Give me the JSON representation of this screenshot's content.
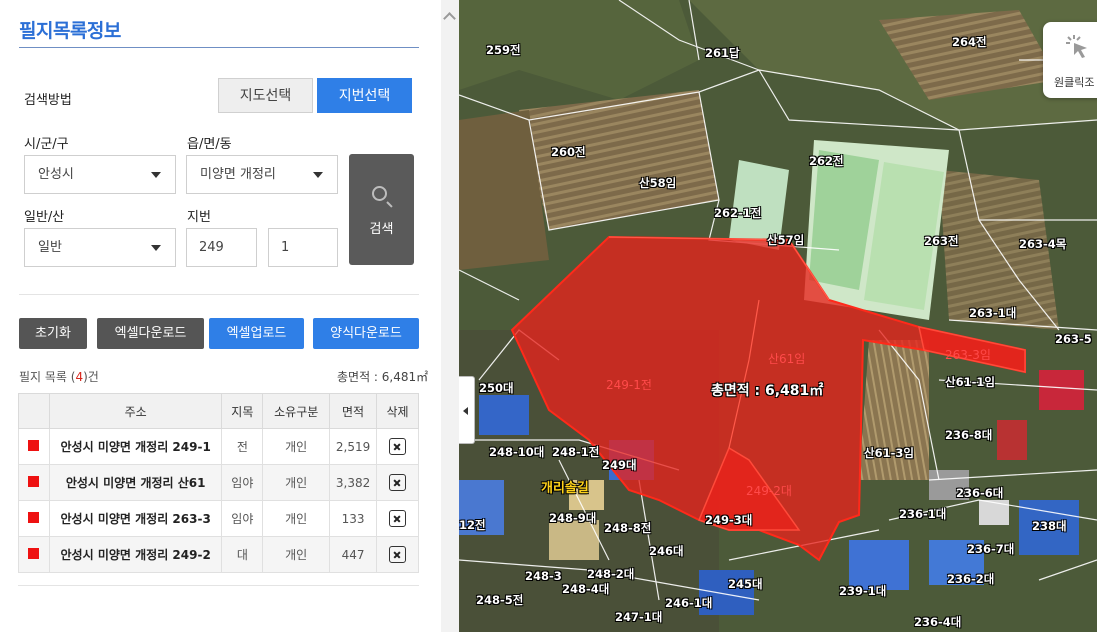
{
  "panel": {
    "title": "필지목록정보",
    "search_method_label": "검색방법",
    "toggle_map": "지도선택",
    "toggle_lot": "지번선택",
    "city_label": "시/군/구",
    "city_value": "안성시",
    "town_label": "읍/면/동",
    "town_value": "미양면 개정리",
    "type_label": "일반/산",
    "type_value": "일반",
    "lot_label": "지번",
    "lot_main": "249",
    "lot_sub": "1",
    "search_button": "검색",
    "actions": [
      "초기화",
      "엑셀다운로드",
      "엑셀업로드",
      "양식다운로드"
    ],
    "count_prefix": "필지 목록 (",
    "count_value": "4",
    "count_suffix": ")건",
    "total_area": "총면적 : 6,481㎡",
    "table": {
      "headers": [
        "",
        "주소",
        "지목",
        "소유구분",
        "면적",
        "삭제"
      ],
      "rows": [
        {
          "address": "안성시 미양면 개정리 249-1",
          "category": "전",
          "ownership": "개인",
          "area": "2,519"
        },
        {
          "address": "안성시 미양면 개정리 산61",
          "category": "임야",
          "ownership": "개인",
          "area": "3,382"
        },
        {
          "address": "안성시 미양면 개정리 263-3",
          "category": "임야",
          "ownership": "개인",
          "area": "133"
        },
        {
          "address": "안성시 미양면 개정리 249-2",
          "category": "대",
          "ownership": "개인",
          "area": "447"
        }
      ]
    }
  },
  "map": {
    "total_area_label": "총면적 : 6,481㎡",
    "one_click_label": "원클릭조",
    "selected_parcels": [
      "249-1전",
      "산61임",
      "263-3임",
      "249-2대"
    ],
    "parcel_labels": [
      "259전",
      "261답",
      "264전",
      "260전",
      "262전",
      "산58임",
      "262-1전",
      "산57임",
      "263전",
      "263-4목",
      "263-1대",
      "263-5",
      "250대",
      "248-10대",
      "248-1전",
      "249대",
      "산61-1임",
      "236-8대",
      "산61-3임",
      "236-6대",
      "236-1대",
      "238대",
      "248-9대",
      "248-8전",
      "249-3대",
      "246대",
      "236-7대",
      "248-3",
      "248-2대",
      "248-4대",
      "245대",
      "236-2대",
      "239-1대",
      "248-5전",
      "246-1대",
      "247-1대",
      "236-4대",
      "12전"
    ],
    "road_name": "개리솔길",
    "colors": {
      "selected_fill": "#e8231c",
      "selected_outline": "#ff2a1a",
      "parcel_line": "#ffffff"
    }
  }
}
